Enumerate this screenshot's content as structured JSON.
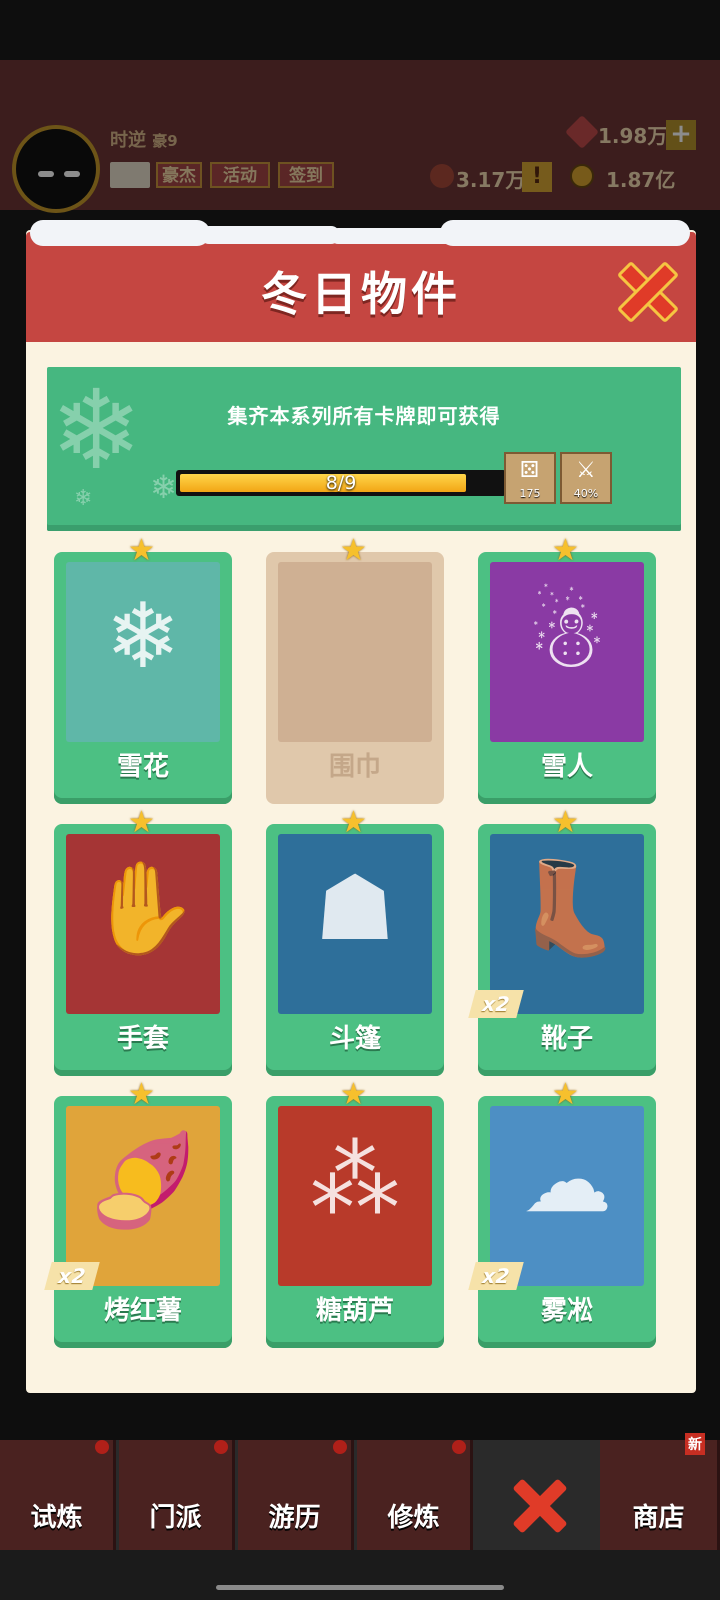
{
  "header": {
    "player_name": "时逆",
    "vip_label": "豪9",
    "buttons": [
      "豪杰",
      "活动",
      "签到"
    ],
    "resources": {
      "gems": "1.98万",
      "power": "3.17万",
      "coins": "1.87亿"
    },
    "icons": [
      "mail-icon",
      "gem-icon",
      "plus-icon",
      "power-icon",
      "alert-icon",
      "coin-icon"
    ]
  },
  "panel": {
    "title": "冬日物件",
    "close_icon": "close-x-icon",
    "banner_text": "集齐本系列所有卡牌即可获得",
    "progress": {
      "text": "8/9",
      "value": 8,
      "max": 9
    },
    "rewards": [
      {
        "icon": "dice-icon",
        "count": "175"
      },
      {
        "icon": "sword-icon",
        "count": "40%"
      }
    ]
  },
  "cards": [
    {
      "name": "雪花",
      "owned": true,
      "badge": "",
      "art": "snowflake",
      "color": "#5fb7a8"
    },
    {
      "name": "围巾",
      "owned": false,
      "badge": "",
      "art": "",
      "color": "#cfb093"
    },
    {
      "name": "雪人",
      "owned": true,
      "badge": "",
      "art": "snowman",
      "color": "#8a3aa4"
    },
    {
      "name": "手套",
      "owned": true,
      "badge": "",
      "art": "gloves",
      "color": "#a53535"
    },
    {
      "name": "斗篷",
      "owned": true,
      "badge": "",
      "art": "cloak",
      "color": "#2e6f9a"
    },
    {
      "name": "靴子",
      "owned": true,
      "badge": "x2",
      "art": "boots",
      "color": "#2e6f9a"
    },
    {
      "name": "烤红薯",
      "owned": true,
      "badge": "x2",
      "art": "sweet-potato",
      "color": "#e0a43a"
    },
    {
      "name": "糖葫芦",
      "owned": true,
      "badge": "",
      "art": "candied-haws",
      "color": "#b83a2a"
    },
    {
      "name": "雾凇",
      "owned": true,
      "badge": "x2",
      "art": "rime-tree",
      "color": "#4d8fc4"
    }
  ],
  "nav": {
    "items": [
      "试炼",
      "门派",
      "游历",
      "修炼",
      "商店"
    ],
    "new_tag": "新"
  }
}
